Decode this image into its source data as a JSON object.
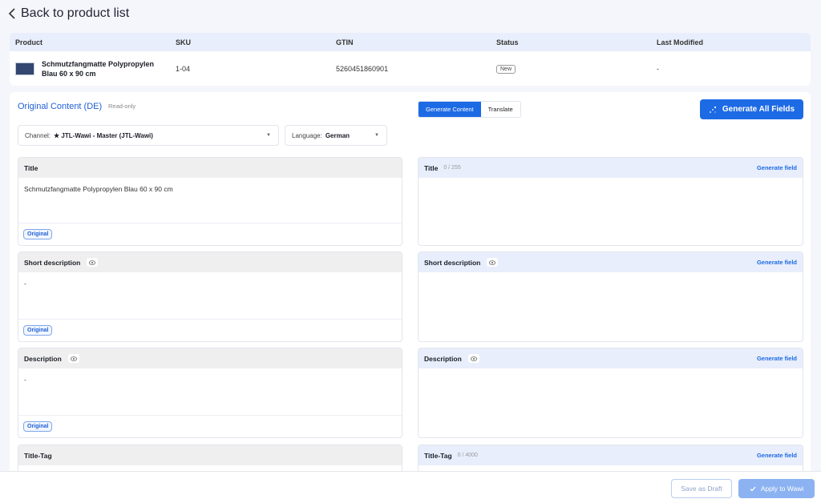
{
  "nav": {
    "back_label": "Back to product list"
  },
  "product_table": {
    "headers": [
      "Product",
      "SKU",
      "GTIN",
      "Status",
      "Last Modified"
    ],
    "row": {
      "name_line1": "Schmutzfangmatte Polypropylen",
      "name_line2": "Blau 60 x 90 cm",
      "sku": "1-04",
      "gtin": "5260451860901",
      "status": "New",
      "last_modified": "-"
    }
  },
  "content": {
    "title": "Original Content (DE)",
    "readonly_label": "Read-only",
    "tabs": [
      {
        "label": "Generate Content",
        "active": true
      },
      {
        "label": "Translate",
        "active": false
      }
    ],
    "generate_all_label": "Generate All Fields",
    "channel": {
      "label": "Channel:",
      "value": "★ JTL-Wawi - Master (JTL-Wawi)"
    },
    "language": {
      "label": "Language:",
      "value": "German"
    },
    "original_fields": [
      {
        "label": "Title",
        "value": "Schmutzfangmatte Polypropylen Blau 60 x 90 cm",
        "badge": "Original"
      },
      {
        "label": "Short description",
        "value": "-",
        "badge": "Original"
      },
      {
        "label": "Description",
        "value": "-",
        "badge": "Original"
      },
      {
        "label": "Title-Tag",
        "value": "",
        "badge": ""
      }
    ],
    "generated_fields": [
      {
        "label": "Title",
        "count": "0 / 255",
        "action": "Generate field"
      },
      {
        "label": "Short description",
        "count": "",
        "action": "Generate field"
      },
      {
        "label": "Description",
        "count": "",
        "action": "Generate field"
      },
      {
        "label": "Title-Tag",
        "count": "0 / 4000",
        "action": "Generate field"
      }
    ]
  },
  "footer": {
    "save_draft_label": "Save as Draft",
    "apply_label": "Apply to Wawi"
  },
  "colors": {
    "accent": "#1d6ae5",
    "accent_disabled": "#8cb2f1"
  },
  "icons": [
    "chevron-left-icon",
    "sparkle-icon",
    "eye-icon",
    "check-icon",
    "caret-down-icon"
  ]
}
